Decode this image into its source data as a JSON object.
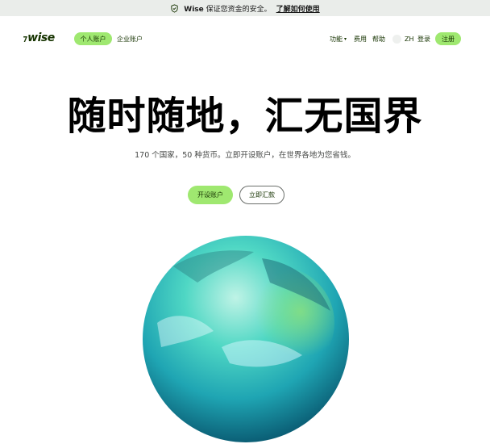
{
  "banner": {
    "brand": "Wise",
    "text": "保证您资金的安全。",
    "link": "了解如何使用"
  },
  "nav": {
    "logo": "wise",
    "tabs": [
      {
        "label": "个人账户",
        "active": true
      },
      {
        "label": "企业账户",
        "active": false
      }
    ],
    "features": "功能",
    "fees": "费用",
    "help": "帮助",
    "language": "ZH",
    "login": "登录",
    "signup": "注册"
  },
  "hero": {
    "title": "随时随地，汇无国界",
    "subtitle": "170 个国家，50 种货币。立即开设账户，在世界各地为您省钱。",
    "cta_primary": "开设账户",
    "cta_secondary": "立即汇款"
  },
  "colors": {
    "accent": "#9fe870",
    "brand_dark": "#163300",
    "banner_bg": "#eaedea"
  },
  "icons": {
    "banner": "shield-icon",
    "nav_caret": "chevron-down-icon",
    "lang": "globe-icon"
  }
}
